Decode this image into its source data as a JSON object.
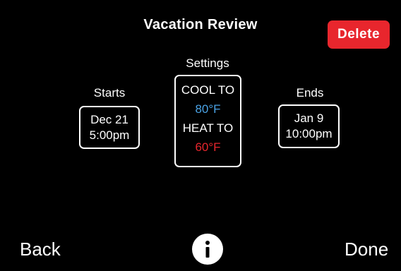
{
  "header": {
    "title": "Vacation Review",
    "delete_label": "Delete"
  },
  "starts": {
    "label": "Starts",
    "date": "Dec 21",
    "time": "5:00pm"
  },
  "settings": {
    "label": "Settings",
    "cool_label": "COOL TO",
    "cool_value": "80°F",
    "heat_label": "HEAT TO",
    "heat_value": "60°F"
  },
  "ends": {
    "label": "Ends",
    "date": "Jan 9",
    "time": "10:00pm"
  },
  "footer": {
    "back_label": "Back",
    "done_label": "Done",
    "info_icon": "info-icon"
  },
  "colors": {
    "background": "#000000",
    "delete": "#e8262d",
    "cool": "#4aa3e6",
    "heat": "#e8262d"
  }
}
